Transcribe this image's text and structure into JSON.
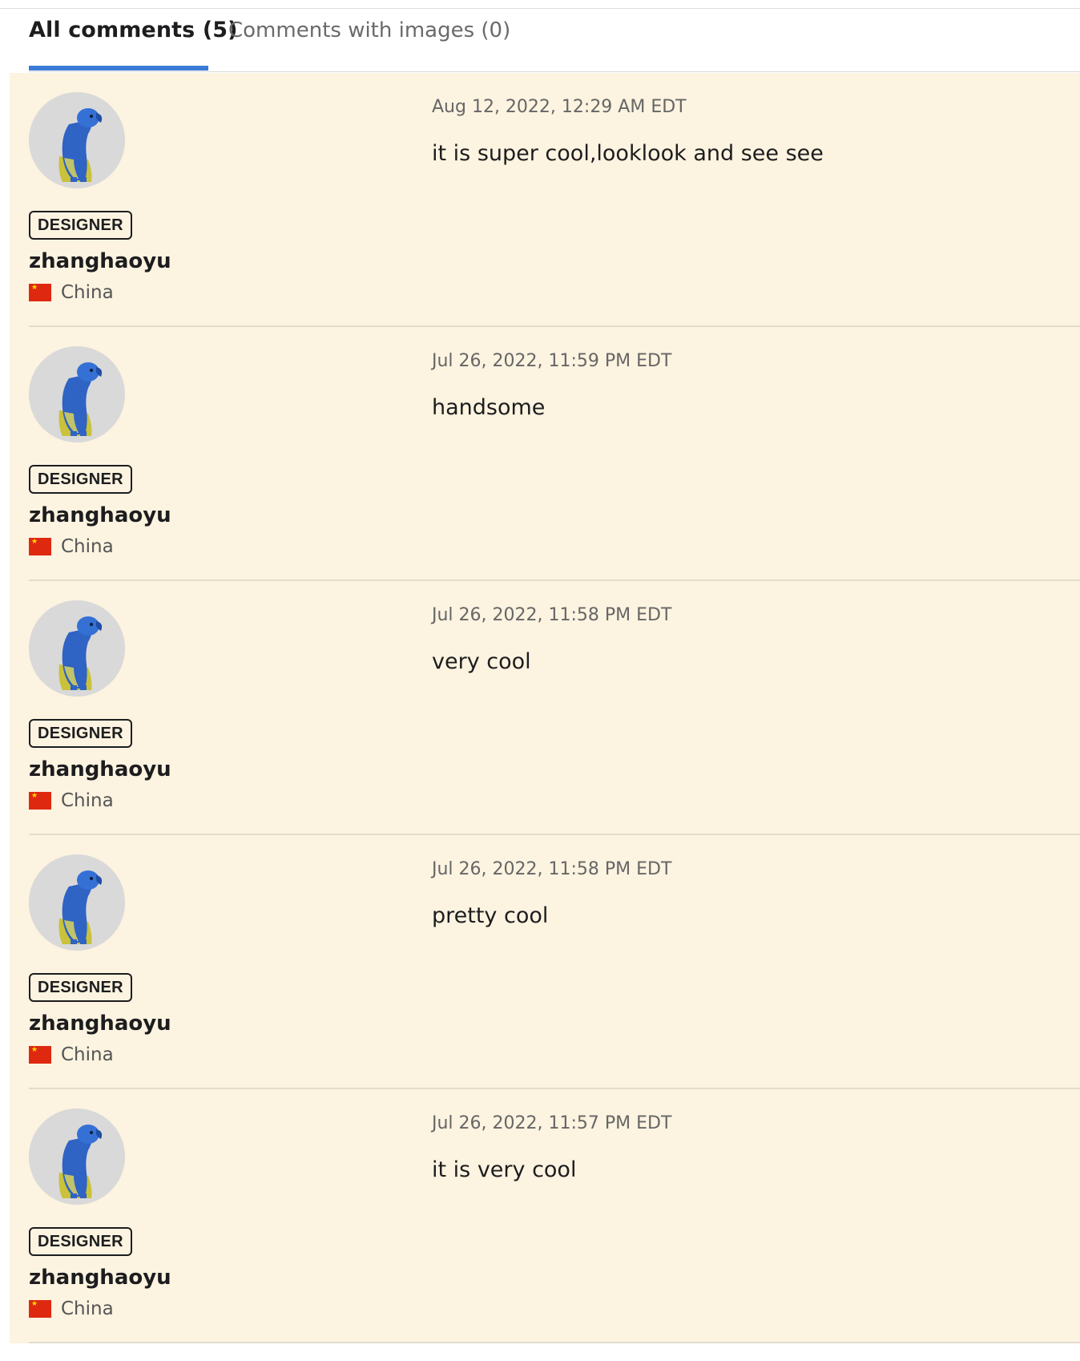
{
  "tabs": [
    {
      "label": "All comments (5)",
      "active": true
    },
    {
      "label": "Comments with images (0)",
      "active": false
    }
  ],
  "colors": {
    "accent": "#3a7bd5",
    "comment_bg": "#fcf3e0",
    "flag_red": "#de2910"
  },
  "comments": [
    {
      "avatar_icon": "blue-parrot-avatar",
      "badge": "DESIGNER",
      "username": "zhanghaoyu",
      "country": "China",
      "flag_icon": "china-flag-icon",
      "date": "Aug 12, 2022, 12:29 AM EDT",
      "text": "it is super cool,looklook and see see"
    },
    {
      "avatar_icon": "blue-parrot-avatar",
      "badge": "DESIGNER",
      "username": "zhanghaoyu",
      "country": "China",
      "flag_icon": "china-flag-icon",
      "date": "Jul 26, 2022, 11:59 PM EDT",
      "text": "handsome"
    },
    {
      "avatar_icon": "blue-parrot-avatar",
      "badge": "DESIGNER",
      "username": "zhanghaoyu",
      "country": "China",
      "flag_icon": "china-flag-icon",
      "date": "Jul 26, 2022, 11:58 PM EDT",
      "text": "very cool"
    },
    {
      "avatar_icon": "blue-parrot-avatar",
      "badge": "DESIGNER",
      "username": "zhanghaoyu",
      "country": "China",
      "flag_icon": "china-flag-icon",
      "date": "Jul 26, 2022, 11:58 PM EDT",
      "text": "pretty cool"
    },
    {
      "avatar_icon": "blue-parrot-avatar",
      "badge": "DESIGNER",
      "username": "zhanghaoyu",
      "country": "China",
      "flag_icon": "china-flag-icon",
      "date": "Jul 26, 2022, 11:57 PM EDT",
      "text": "it is very cool"
    }
  ]
}
